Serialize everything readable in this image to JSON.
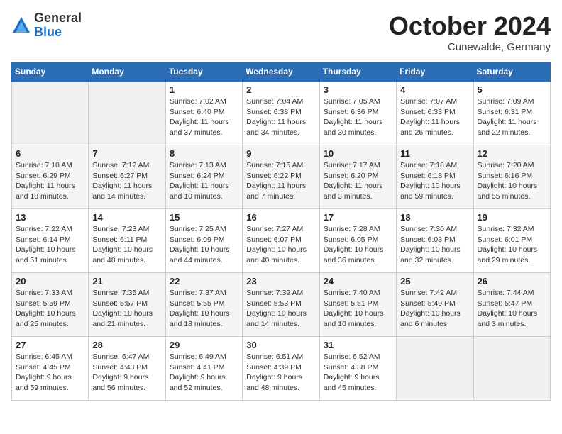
{
  "header": {
    "logo_general": "General",
    "logo_blue": "Blue",
    "month": "October 2024",
    "location": "Cunewalde, Germany"
  },
  "weekdays": [
    "Sunday",
    "Monday",
    "Tuesday",
    "Wednesday",
    "Thursday",
    "Friday",
    "Saturday"
  ],
  "weeks": [
    [
      {
        "day": "",
        "empty": true
      },
      {
        "day": "",
        "empty": true
      },
      {
        "day": "1",
        "sunrise": "Sunrise: 7:02 AM",
        "sunset": "Sunset: 6:40 PM",
        "daylight": "Daylight: 11 hours and 37 minutes."
      },
      {
        "day": "2",
        "sunrise": "Sunrise: 7:04 AM",
        "sunset": "Sunset: 6:38 PM",
        "daylight": "Daylight: 11 hours and 34 minutes."
      },
      {
        "day": "3",
        "sunrise": "Sunrise: 7:05 AM",
        "sunset": "Sunset: 6:36 PM",
        "daylight": "Daylight: 11 hours and 30 minutes."
      },
      {
        "day": "4",
        "sunrise": "Sunrise: 7:07 AM",
        "sunset": "Sunset: 6:33 PM",
        "daylight": "Daylight: 11 hours and 26 minutes."
      },
      {
        "day": "5",
        "sunrise": "Sunrise: 7:09 AM",
        "sunset": "Sunset: 6:31 PM",
        "daylight": "Daylight: 11 hours and 22 minutes."
      }
    ],
    [
      {
        "day": "6",
        "sunrise": "Sunrise: 7:10 AM",
        "sunset": "Sunset: 6:29 PM",
        "daylight": "Daylight: 11 hours and 18 minutes."
      },
      {
        "day": "7",
        "sunrise": "Sunrise: 7:12 AM",
        "sunset": "Sunset: 6:27 PM",
        "daylight": "Daylight: 11 hours and 14 minutes."
      },
      {
        "day": "8",
        "sunrise": "Sunrise: 7:13 AM",
        "sunset": "Sunset: 6:24 PM",
        "daylight": "Daylight: 11 hours and 10 minutes."
      },
      {
        "day": "9",
        "sunrise": "Sunrise: 7:15 AM",
        "sunset": "Sunset: 6:22 PM",
        "daylight": "Daylight: 11 hours and 7 minutes."
      },
      {
        "day": "10",
        "sunrise": "Sunrise: 7:17 AM",
        "sunset": "Sunset: 6:20 PM",
        "daylight": "Daylight: 11 hours and 3 minutes."
      },
      {
        "day": "11",
        "sunrise": "Sunrise: 7:18 AM",
        "sunset": "Sunset: 6:18 PM",
        "daylight": "Daylight: 10 hours and 59 minutes."
      },
      {
        "day": "12",
        "sunrise": "Sunrise: 7:20 AM",
        "sunset": "Sunset: 6:16 PM",
        "daylight": "Daylight: 10 hours and 55 minutes."
      }
    ],
    [
      {
        "day": "13",
        "sunrise": "Sunrise: 7:22 AM",
        "sunset": "Sunset: 6:14 PM",
        "daylight": "Daylight: 10 hours and 51 minutes."
      },
      {
        "day": "14",
        "sunrise": "Sunrise: 7:23 AM",
        "sunset": "Sunset: 6:11 PM",
        "daylight": "Daylight: 10 hours and 48 minutes."
      },
      {
        "day": "15",
        "sunrise": "Sunrise: 7:25 AM",
        "sunset": "Sunset: 6:09 PM",
        "daylight": "Daylight: 10 hours and 44 minutes."
      },
      {
        "day": "16",
        "sunrise": "Sunrise: 7:27 AM",
        "sunset": "Sunset: 6:07 PM",
        "daylight": "Daylight: 10 hours and 40 minutes."
      },
      {
        "day": "17",
        "sunrise": "Sunrise: 7:28 AM",
        "sunset": "Sunset: 6:05 PM",
        "daylight": "Daylight: 10 hours and 36 minutes."
      },
      {
        "day": "18",
        "sunrise": "Sunrise: 7:30 AM",
        "sunset": "Sunset: 6:03 PM",
        "daylight": "Daylight: 10 hours and 32 minutes."
      },
      {
        "day": "19",
        "sunrise": "Sunrise: 7:32 AM",
        "sunset": "Sunset: 6:01 PM",
        "daylight": "Daylight: 10 hours and 29 minutes."
      }
    ],
    [
      {
        "day": "20",
        "sunrise": "Sunrise: 7:33 AM",
        "sunset": "Sunset: 5:59 PM",
        "daylight": "Daylight: 10 hours and 25 minutes."
      },
      {
        "day": "21",
        "sunrise": "Sunrise: 7:35 AM",
        "sunset": "Sunset: 5:57 PM",
        "daylight": "Daylight: 10 hours and 21 minutes."
      },
      {
        "day": "22",
        "sunrise": "Sunrise: 7:37 AM",
        "sunset": "Sunset: 5:55 PM",
        "daylight": "Daylight: 10 hours and 18 minutes."
      },
      {
        "day": "23",
        "sunrise": "Sunrise: 7:39 AM",
        "sunset": "Sunset: 5:53 PM",
        "daylight": "Daylight: 10 hours and 14 minutes."
      },
      {
        "day": "24",
        "sunrise": "Sunrise: 7:40 AM",
        "sunset": "Sunset: 5:51 PM",
        "daylight": "Daylight: 10 hours and 10 minutes."
      },
      {
        "day": "25",
        "sunrise": "Sunrise: 7:42 AM",
        "sunset": "Sunset: 5:49 PM",
        "daylight": "Daylight: 10 hours and 6 minutes."
      },
      {
        "day": "26",
        "sunrise": "Sunrise: 7:44 AM",
        "sunset": "Sunset: 5:47 PM",
        "daylight": "Daylight: 10 hours and 3 minutes."
      }
    ],
    [
      {
        "day": "27",
        "sunrise": "Sunrise: 6:45 AM",
        "sunset": "Sunset: 4:45 PM",
        "daylight": "Daylight: 9 hours and 59 minutes."
      },
      {
        "day": "28",
        "sunrise": "Sunrise: 6:47 AM",
        "sunset": "Sunset: 4:43 PM",
        "daylight": "Daylight: 9 hours and 56 minutes."
      },
      {
        "day": "29",
        "sunrise": "Sunrise: 6:49 AM",
        "sunset": "Sunset: 4:41 PM",
        "daylight": "Daylight: 9 hours and 52 minutes."
      },
      {
        "day": "30",
        "sunrise": "Sunrise: 6:51 AM",
        "sunset": "Sunset: 4:39 PM",
        "daylight": "Daylight: 9 hours and 48 minutes."
      },
      {
        "day": "31",
        "sunrise": "Sunrise: 6:52 AM",
        "sunset": "Sunset: 4:38 PM",
        "daylight": "Daylight: 9 hours and 45 minutes."
      },
      {
        "day": "",
        "empty": true
      },
      {
        "day": "",
        "empty": true
      }
    ]
  ]
}
